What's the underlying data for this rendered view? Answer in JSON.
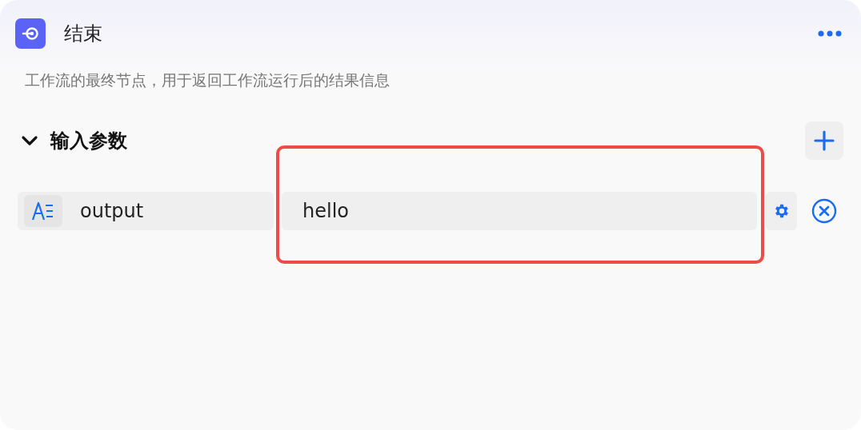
{
  "node": {
    "title": "结束",
    "description": "工作流的最终节点，用于返回工作流运行后的结果信息"
  },
  "section": {
    "title": "输入参数",
    "expanded": true
  },
  "params": [
    {
      "name": "output",
      "value": "hello",
      "highlighted": true
    }
  ]
}
